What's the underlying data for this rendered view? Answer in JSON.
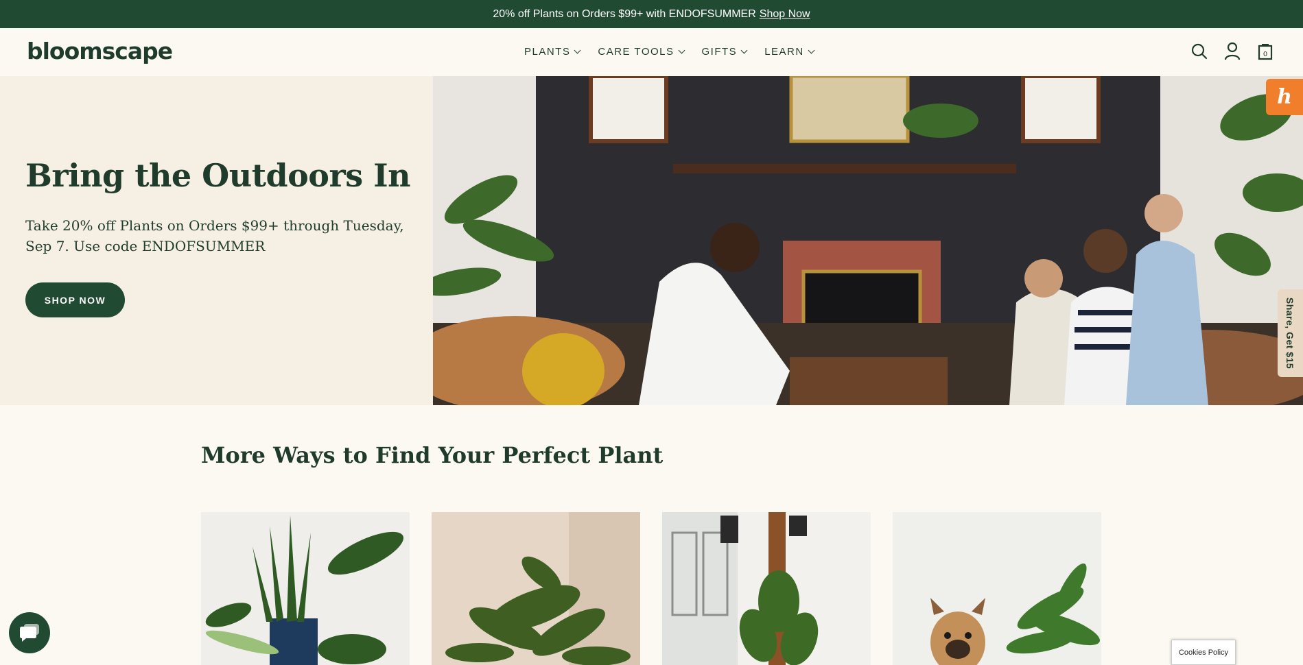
{
  "promo": {
    "text": "20% off Plants on Orders $99+ with ENDOFSUMMER",
    "link": "Shop Now"
  },
  "header": {
    "logo": "bloomscape",
    "nav": [
      {
        "label": "PLANTS"
      },
      {
        "label": "CARE TOOLS"
      },
      {
        "label": "GIFTS"
      },
      {
        "label": "LEARN"
      }
    ],
    "icons": [
      "search-icon",
      "account-icon",
      "cart-icon"
    ],
    "cart_count": "0"
  },
  "hero": {
    "title": "Bring the Outdoors In",
    "subtitle": "Take 20% off Plants on Orders $99+ through Tuesday, Sep 7. Use code ENDOFSUMMER",
    "button": "SHOP NOW"
  },
  "widgets": {
    "honey_letter": "h",
    "share_tab": "Share, Get $15",
    "cookie": "Cookies Policy"
  },
  "section": {
    "title": "More Ways to Find Your Perfect Plant"
  },
  "colors": {
    "brand_green": "#214a33",
    "cream": "#fcf9f3",
    "hero_bg": "#f6efe3",
    "honey_orange": "#f07e2a"
  }
}
